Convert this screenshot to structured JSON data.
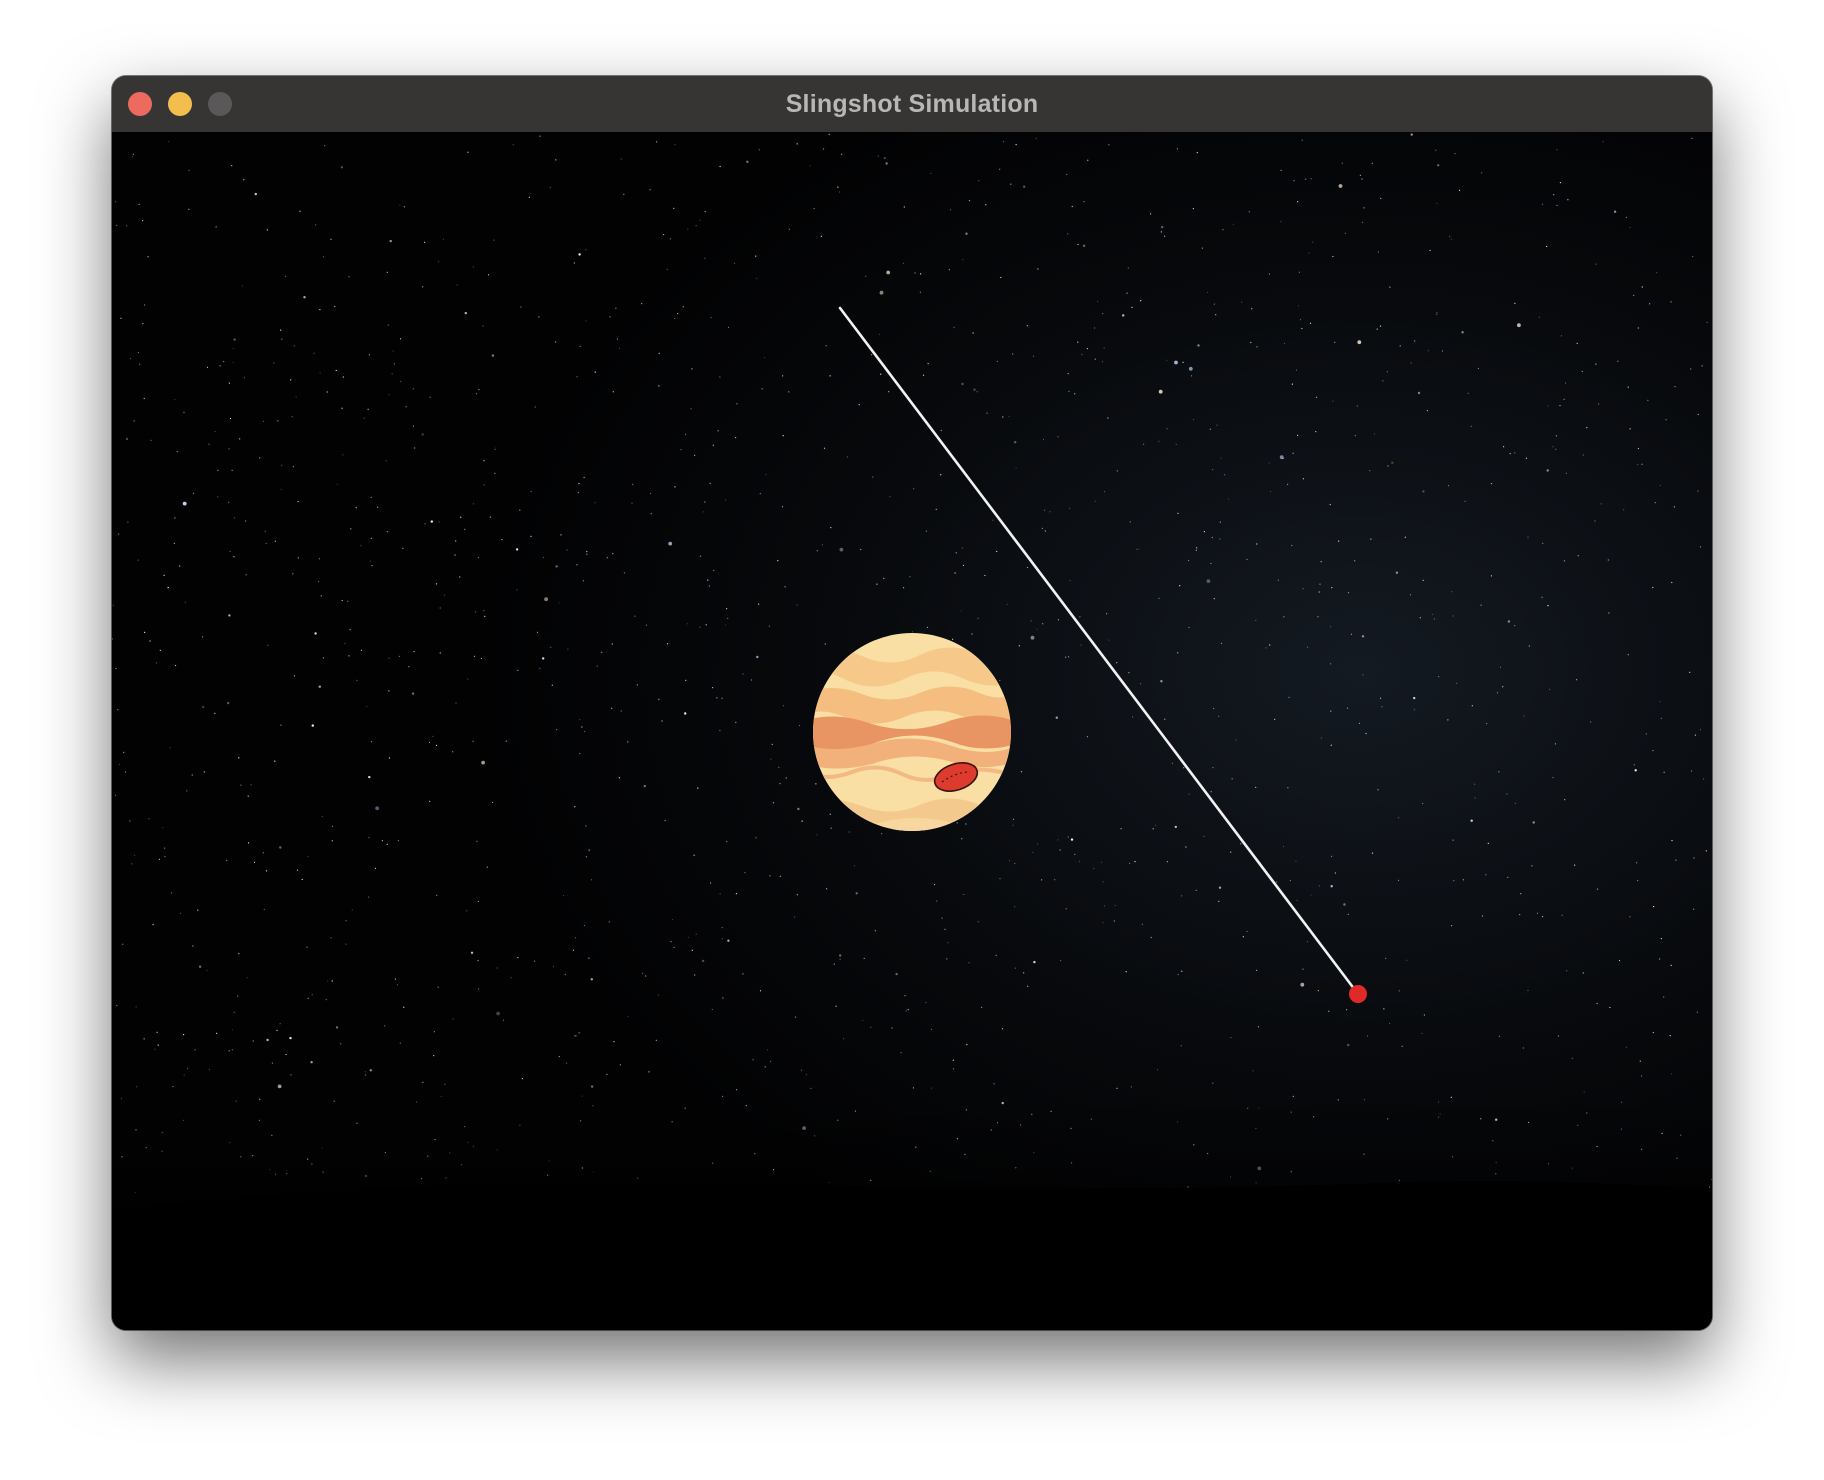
{
  "window": {
    "title": "Slingshot Simulation",
    "controls": {
      "close_color": "#ec6a5e",
      "minimize_color": "#f4be4f",
      "maximize_color": "#5a5858"
    }
  },
  "scene": {
    "background": "starry-night-sky",
    "planet": {
      "name": "jupiter-like-planet",
      "colors": [
        "#f9dfa3",
        "#f3b27a",
        "#e98e5c",
        "#d8362e"
      ]
    },
    "trajectory_color": "#ffffff",
    "projectile_color": "#e02a27"
  }
}
